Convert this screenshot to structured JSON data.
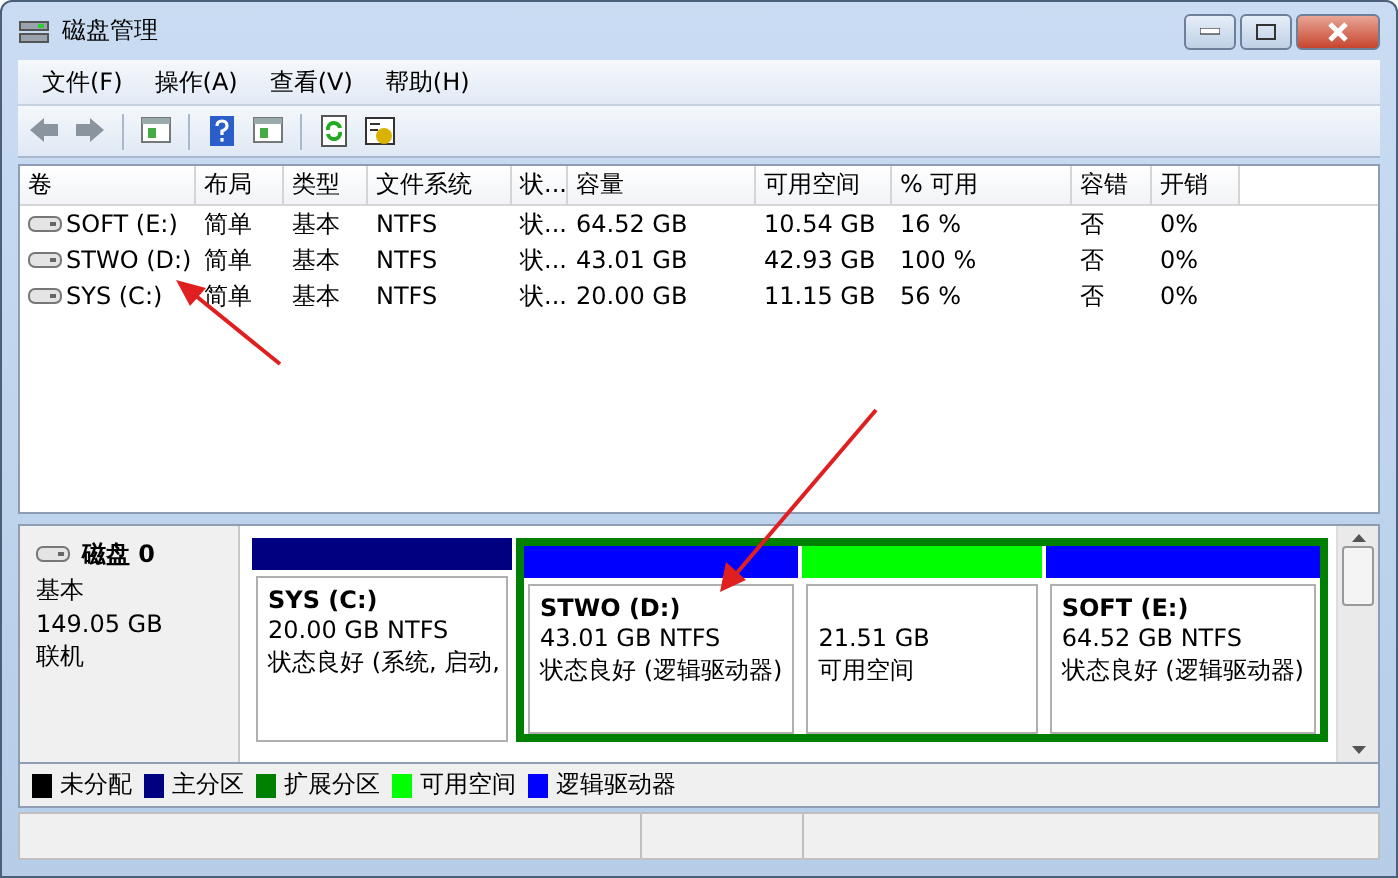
{
  "window": {
    "title": "磁盘管理"
  },
  "menu": [
    "文件(F)",
    "操作(A)",
    "查看(V)",
    "帮助(H)"
  ],
  "table": {
    "columns": [
      "卷",
      "布局",
      "类型",
      "文件系统",
      "状...",
      "容量",
      "可用空间",
      "% 可用",
      "容错",
      "开销"
    ],
    "rows": [
      [
        "SOFT (E:)",
        "简单",
        "基本",
        "NTFS",
        "状...",
        "64.52 GB",
        "10.54 GB",
        "16 %",
        "否",
        "0%"
      ],
      [
        "STWO (D:)",
        "简单",
        "基本",
        "NTFS",
        "状...",
        "43.01 GB",
        "42.93 GB",
        "100 %",
        "否",
        "0%"
      ],
      [
        "SYS (C:)",
        "简单",
        "基本",
        "NTFS",
        "状...",
        "20.00 GB",
        "11.15 GB",
        "56 %",
        "否",
        "0%"
      ]
    ]
  },
  "disk": {
    "name": "磁盘 0",
    "type": "基本",
    "size": "149.05 GB",
    "status": "联机",
    "partitions": [
      {
        "name": "SYS  (C:)",
        "size": "20.00 GB NTFS",
        "status": "状态良好 (系统, 启动,",
        "color": "#000080"
      }
    ],
    "extended": {
      "color": "#008000",
      "partitions": [
        {
          "name": "STWO  (D:)",
          "size": "43.01 GB NTFS",
          "status": "状态良好 (逻辑驱动器)",
          "color": "#0000ff"
        },
        {
          "size": "21.51 GB",
          "status": "可用空间",
          "color": "#00ff00"
        },
        {
          "name": "SOFT  (E:)",
          "size": "64.52 GB NTFS",
          "status": "状态良好 (逻辑驱动器)",
          "color": "#0000ff"
        }
      ]
    }
  },
  "legend": [
    {
      "label": "未分配",
      "color": "#000000"
    },
    {
      "label": "主分区",
      "color": "#000080"
    },
    {
      "label": "扩展分区",
      "color": "#008000"
    },
    {
      "label": "可用空间",
      "color": "#00ff00"
    },
    {
      "label": "逻辑驱动器",
      "color": "#0000ff"
    }
  ]
}
